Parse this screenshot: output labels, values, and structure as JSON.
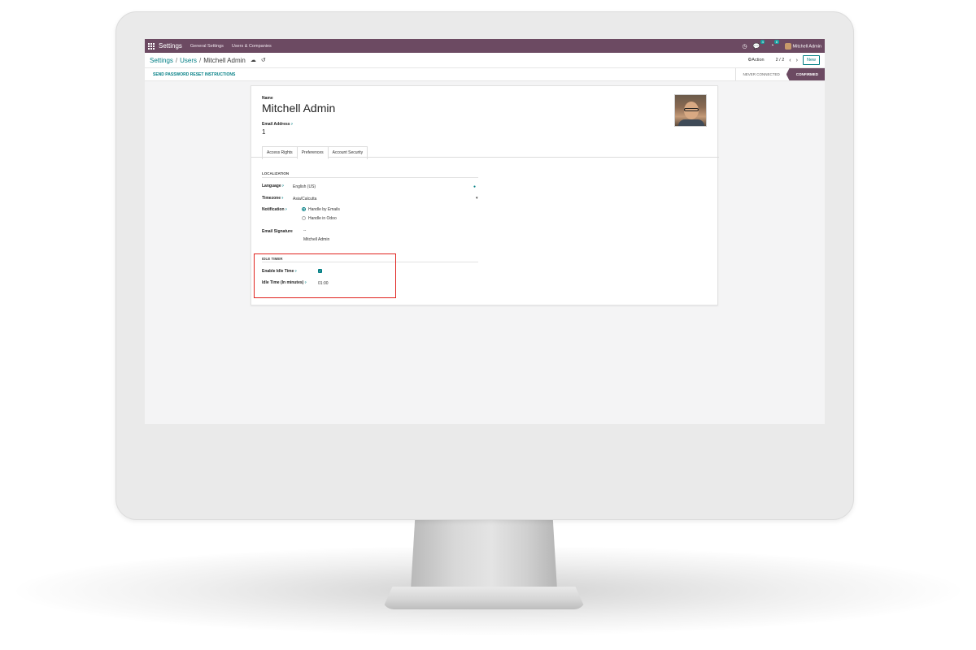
{
  "navbar": {
    "app_title": "Settings",
    "menu": [
      "General Settings",
      "Users & Companies"
    ],
    "messages_count": "4",
    "activity_count": "8",
    "user_name": "Mitchell Admin",
    "bg_color": "#6c4a62"
  },
  "control_panel": {
    "breadcrumb": [
      "Settings",
      "Users",
      "Mitchell Admin"
    ],
    "action_label": "Action",
    "pager": "2 / 2",
    "new_label": "New"
  },
  "statusbar": {
    "reset_button": "SEND PASSWORD RESET INSTRUCTIONS",
    "stages": [
      "NEVER CONNECTED",
      "CONFIRMED"
    ],
    "active_stage": "CONFIRMED"
  },
  "form": {
    "name_label": "Name",
    "name_value": "Mitchell Admin",
    "email_label": "Email Address",
    "email_value": "1",
    "tabs": [
      "Access Rights",
      "Preferences",
      "Account Security"
    ],
    "active_tab": "Preferences",
    "localization": {
      "title": "LOCALIZATION",
      "language_label": "Language",
      "language_value": "English (US)",
      "timezone_label": "Timezone",
      "timezone_value": "Asia/Calcutta",
      "notification_label": "Notification",
      "notification_options": [
        "Handle by Emails",
        "Handle in Odoo"
      ],
      "notification_selected": "Handle by Emails",
      "signature_label": "Email Signature",
      "signature_lines": [
        "--",
        "Mitchell Admin"
      ]
    },
    "idle_timer": {
      "title": "IDLE TIMER",
      "enable_label": "Enable Idle Time",
      "enable_checked": true,
      "time_label": "Idle Time (In minutes)",
      "time_value": "01:00"
    }
  },
  "accent_color": "#017e84",
  "highlight_color": "#e0221e"
}
